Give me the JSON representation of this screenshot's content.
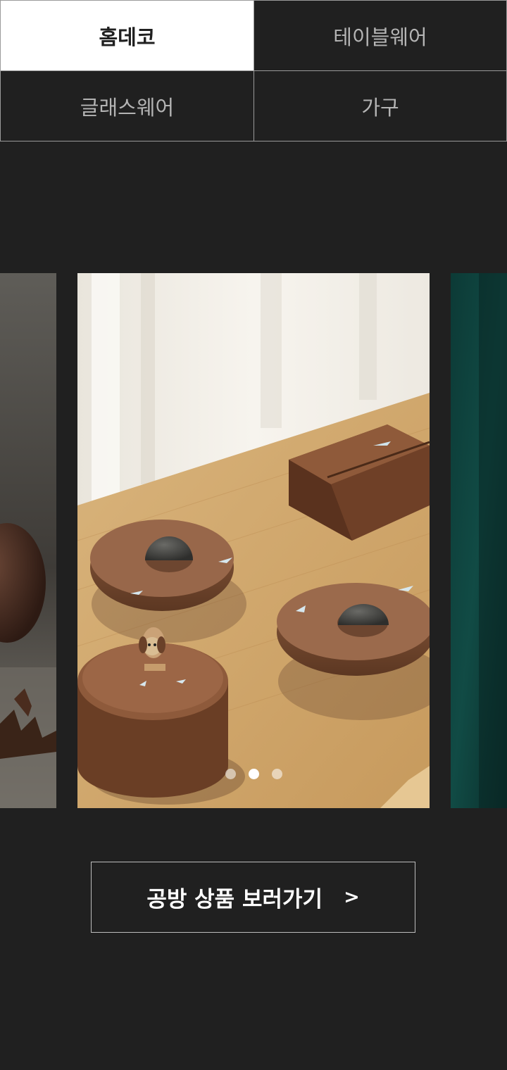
{
  "tabs": [
    {
      "label": "홈데코",
      "active": true
    },
    {
      "label": "테이블웨어",
      "active": false
    },
    {
      "label": "글래스웨어",
      "active": false
    },
    {
      "label": "가구",
      "active": false
    }
  ],
  "carousel": {
    "slide_count": 3,
    "current_index": 1
  },
  "cta": {
    "label": "공방 상품 보러가기",
    "arrow": ">"
  },
  "colors": {
    "background": "#202020",
    "tab_active_bg": "#ffffff",
    "tab_text": "#b4b4b4",
    "border": "#9a9a9a"
  }
}
